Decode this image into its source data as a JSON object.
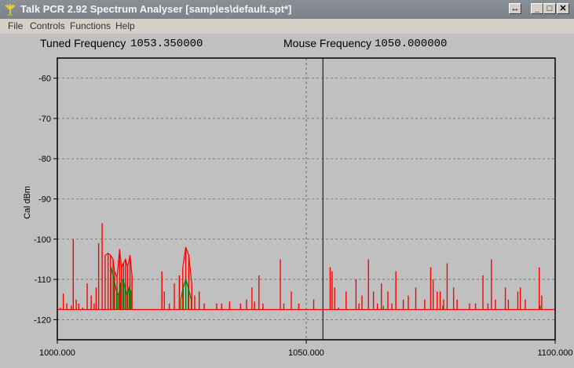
{
  "window": {
    "title": "Talk PCR 2.92 Spectrum Analyser [samples\\default.spt*]"
  },
  "title_buttons": {
    "resize": "↔",
    "minimize": "_",
    "maximize": "□",
    "close": "✕"
  },
  "menu": {
    "items": [
      "File",
      "Controls",
      "Functions",
      "Help"
    ]
  },
  "readouts": {
    "tuned_label": "Tuned Frequency",
    "tuned_value": "1053.350000",
    "mouse_label": "Mouse Frequency",
    "mouse_value": "1050.000000"
  },
  "colors": {
    "red_trace": "#ff0000",
    "green_trace": "#008000",
    "plot_bg": "#c0c0c0",
    "title_bg": "#7d828a"
  },
  "icons": [
    "talkpcr-app-icon",
    "resize-icon",
    "minimize-icon",
    "maximize-icon",
    "close-icon"
  ],
  "chart_data": {
    "type": "line",
    "ylabel": "Cal dBm",
    "xlabel": "",
    "xlim": [
      1000.0,
      1100.0
    ],
    "ylim": [
      -125,
      -55
    ],
    "x_ticks": [
      "1000.000",
      "1050.000",
      "1100.000"
    ],
    "x_tick_values": [
      1000.0,
      1050.0,
      1100.0
    ],
    "y_ticks": [
      -60,
      -70,
      -80,
      -90,
      -100,
      -110,
      -120
    ],
    "grid": true,
    "cursor_lines": {
      "tuned": 1053.35,
      "mouse": 1050.0
    },
    "noise_floor": -117.5,
    "series": [
      {
        "color": "#ff0000",
        "peaks": [
          [
            1000.6,
            -117
          ],
          [
            1001.2,
            -113.5
          ],
          [
            1001.9,
            -116
          ],
          [
            1002.8,
            -116.5
          ],
          [
            1003.2,
            -100
          ],
          [
            1003.8,
            -115
          ],
          [
            1004.3,
            -116
          ],
          [
            1005.1,
            -117
          ],
          [
            1006.0,
            -111
          ],
          [
            1006.8,
            -114
          ],
          [
            1007.4,
            -116
          ],
          [
            1007.8,
            -112
          ],
          [
            1008.3,
            -101
          ],
          [
            1009.0,
            -96
          ],
          [
            1009.6,
            -104
          ],
          [
            1010.2,
            -103.5
          ],
          [
            1010.7,
            -104
          ],
          [
            1011.2,
            -105
          ],
          [
            1011.5,
            -108
          ],
          [
            1012.0,
            -109.5
          ],
          [
            1012.5,
            -102.5
          ],
          [
            1012.9,
            -107
          ],
          [
            1013.3,
            -106
          ],
          [
            1013.7,
            -105
          ],
          [
            1014.1,
            -107
          ],
          [
            1014.6,
            -104
          ],
          [
            1015.0,
            -109
          ],
          [
            1021.0,
            -108
          ],
          [
            1021.5,
            -113
          ],
          [
            1022.5,
            -116
          ],
          [
            1023.5,
            -111
          ],
          [
            1024.5,
            -109
          ],
          [
            1025.2,
            -107
          ],
          [
            1025.8,
            -102
          ],
          [
            1026.4,
            -104
          ],
          [
            1027.0,
            -111
          ],
          [
            1027.6,
            -114
          ],
          [
            1028.5,
            -113
          ],
          [
            1029.5,
            -116
          ],
          [
            1032.0,
            -116
          ],
          [
            1033.0,
            -116
          ],
          [
            1034.6,
            -115.5
          ],
          [
            1036.8,
            -116
          ],
          [
            1038.0,
            -115
          ],
          [
            1039.1,
            -112
          ],
          [
            1039.6,
            -115.5
          ],
          [
            1040.5,
            -109
          ],
          [
            1041.3,
            -116
          ],
          [
            1044.8,
            -105
          ],
          [
            1045.5,
            -116
          ],
          [
            1047.0,
            -113
          ],
          [
            1048.5,
            -116
          ],
          [
            1051.5,
            -115
          ],
          [
            1054.8,
            -107
          ],
          [
            1055.2,
            -108
          ],
          [
            1055.7,
            -112
          ],
          [
            1056.5,
            -117
          ],
          [
            1058.0,
            -113
          ],
          [
            1060.0,
            -110
          ],
          [
            1060.6,
            -116
          ],
          [
            1061.2,
            -114
          ],
          [
            1062.5,
            -105
          ],
          [
            1063.5,
            -113
          ],
          [
            1064.3,
            -116
          ],
          [
            1065.1,
            -111
          ],
          [
            1066.4,
            -113
          ],
          [
            1067.2,
            -116
          ],
          [
            1068.0,
            -108
          ],
          [
            1069.5,
            -115
          ],
          [
            1070.5,
            -114
          ],
          [
            1072.0,
            -112
          ],
          [
            1073.8,
            -115
          ],
          [
            1075.0,
            -107
          ],
          [
            1075.5,
            -110
          ],
          [
            1076.3,
            -113
          ],
          [
            1076.9,
            -113
          ],
          [
            1077.6,
            -115
          ],
          [
            1078.3,
            -106
          ],
          [
            1079.6,
            -112
          ],
          [
            1080.3,
            -115
          ],
          [
            1082.8,
            -116
          ],
          [
            1084.0,
            -116
          ],
          [
            1085.5,
            -109
          ],
          [
            1086.5,
            -116
          ],
          [
            1087.2,
            -105
          ],
          [
            1088.0,
            -115
          ],
          [
            1090.0,
            -112
          ],
          [
            1090.6,
            -115
          ],
          [
            1092.5,
            -113
          ],
          [
            1093.0,
            -112
          ],
          [
            1094.0,
            -115
          ],
          [
            1096.8,
            -107
          ],
          [
            1097.3,
            -114
          ]
        ]
      },
      {
        "color": "#008000",
        "peaks": [
          [
            1010.8,
            -107
          ],
          [
            1011.4,
            -110
          ],
          [
            1011.9,
            -113
          ],
          [
            1012.3,
            -114
          ],
          [
            1012.7,
            -111
          ],
          [
            1013.2,
            -110
          ],
          [
            1013.6,
            -112
          ],
          [
            1014.0,
            -114
          ],
          [
            1014.4,
            -112
          ],
          [
            1014.8,
            -113
          ],
          [
            1024.8,
            -115
          ],
          [
            1025.3,
            -112
          ],
          [
            1025.8,
            -110
          ],
          [
            1026.3,
            -112
          ],
          [
            1026.9,
            -115
          ],
          [
            1065.5,
            -116.5
          ],
          [
            1077.4,
            -116.5
          ],
          [
            1097.0,
            -116.5
          ]
        ]
      }
    ]
  }
}
